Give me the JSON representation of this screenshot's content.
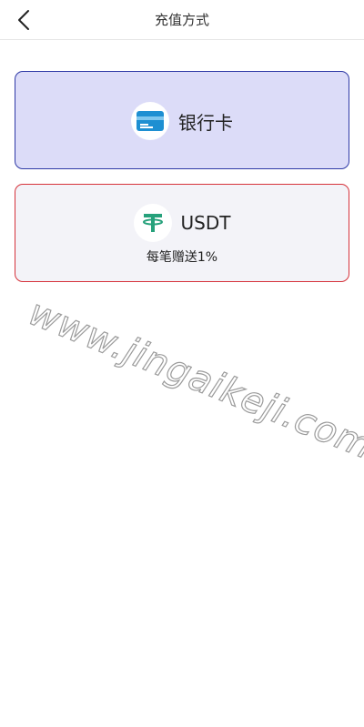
{
  "header": {
    "title": "充值方式"
  },
  "methods": [
    {
      "label": "银行卡",
      "icon": "bank-card-icon",
      "border_color": "#2f3aa6",
      "background": "#dcdcf8"
    },
    {
      "label": "USDT",
      "subtitle": "每笔赠送1%",
      "icon": "tether-icon",
      "border_color": "#d6333b",
      "background": "#f3f3f8"
    }
  ],
  "watermark": "www.jingaikeji.com"
}
